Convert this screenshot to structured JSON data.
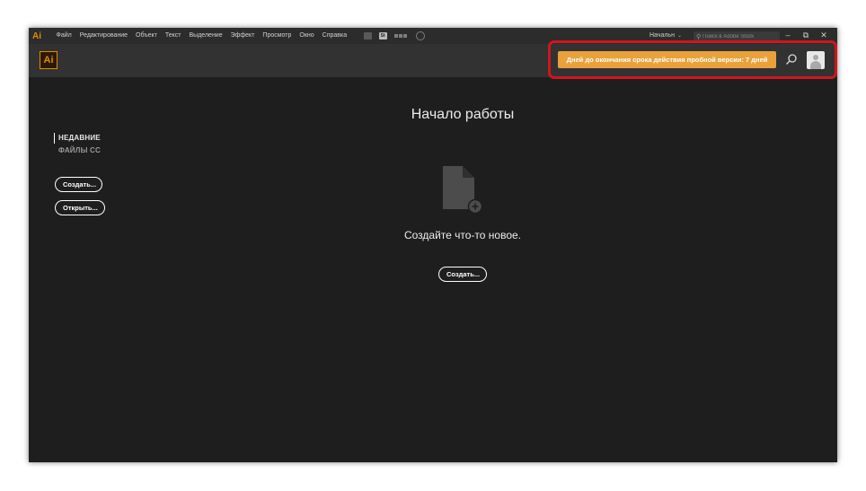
{
  "app": {
    "mini_logo": "Ai",
    "logo": "Ai"
  },
  "menu": {
    "items": [
      "Файл",
      "Редактирование",
      "Объект",
      "Текст",
      "Выделение",
      "Эффект",
      "Просмотр",
      "Окно",
      "Справка"
    ],
    "icons": [
      "bridge-icon",
      "stock-icon",
      "arrange-documents-icon",
      "gpu-performance-icon"
    ],
    "stock_badge": "St"
  },
  "workspace": {
    "label": "Начальн",
    "chevron": "⌄"
  },
  "stock_search": {
    "placeholder": "Поиск в Adobe Stock",
    "icon": "search-icon"
  },
  "window_controls": {
    "minimize": "–",
    "restore": "⧉",
    "close": "✕"
  },
  "header": {
    "trial_label": "Дней до окончания срока действия пробной версии: 7 дней",
    "search_icon": "search-icon",
    "avatar_icon": "user-avatar-icon",
    "highlight_color": "#d2141c",
    "trial_color": "#e9a23b"
  },
  "sidebar": {
    "recent": "НЕДАВНИЕ",
    "cc_files": "ФАЙЛЫ CC",
    "create_label": "Создать...",
    "open_label": "Открыть..."
  },
  "main": {
    "title": "Начало работы",
    "empty_icon": "new-document-icon",
    "empty_text": "Создайте что-то новое.",
    "create_label": "Создать..."
  },
  "colors": {
    "background": "#1e1e1e",
    "accent": "#e68a00"
  }
}
